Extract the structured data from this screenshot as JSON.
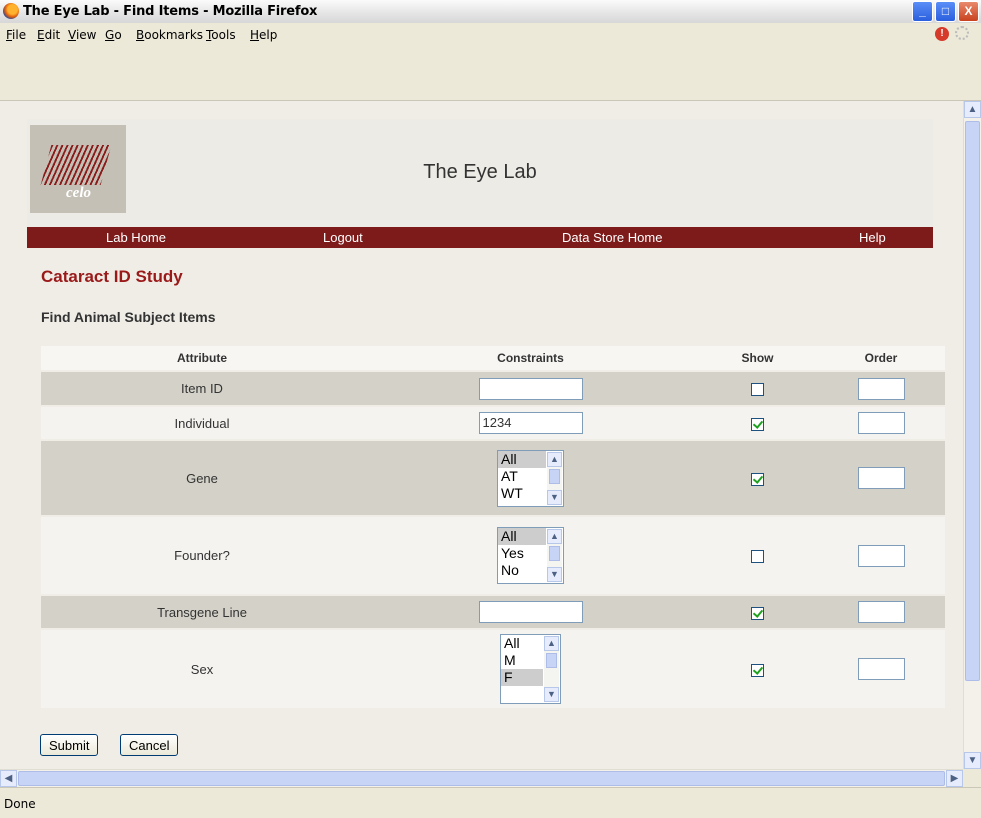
{
  "window": {
    "title": "The Eye Lab - Find Items - Mozilla Firefox",
    "buttons": {
      "minimize": "_",
      "maximize": "□",
      "close": "X"
    }
  },
  "menu": [
    "File",
    "Edit",
    "View",
    "Go",
    "Bookmarks",
    "Tools",
    "Help"
  ],
  "banner": {
    "logo_text": "celo",
    "site_title": "The Eye Lab"
  },
  "nav": [
    "Lab Home",
    "Logout",
    "Data Store Home",
    "Help"
  ],
  "page": {
    "study_title": "Cataract ID Study",
    "find_title": "Find Animal Subject Items"
  },
  "table": {
    "headers": [
      "Attribute",
      "Constraints",
      "Show",
      "Order"
    ],
    "rows": [
      {
        "attribute": "Item ID",
        "constraint_value": "",
        "show": false,
        "order": ""
      },
      {
        "attribute": "Individual",
        "constraint_value": "1234",
        "show": true,
        "order": ""
      },
      {
        "attribute": "Gene",
        "options": [
          "All",
          "AT",
          "WT"
        ],
        "selected": "All",
        "show": true,
        "order": ""
      },
      {
        "attribute": "Founder?",
        "options": [
          "All",
          "Yes",
          "No"
        ],
        "selected": "All",
        "show": false,
        "order": ""
      },
      {
        "attribute": "Transgene Line",
        "constraint_value": "",
        "show": true,
        "order": ""
      },
      {
        "attribute": "Sex",
        "options": [
          "All",
          "M",
          "F"
        ],
        "selected": "F",
        "show": true,
        "order": ""
      }
    ]
  },
  "buttons": {
    "submit": "Submit",
    "cancel": "Cancel"
  },
  "status": "Done",
  "colors": {
    "nav_bg": "#7d1a1a",
    "study_title": "#9a1a1a",
    "row_shade": "#d4d2c8",
    "row_light": "#f5f3ef"
  }
}
